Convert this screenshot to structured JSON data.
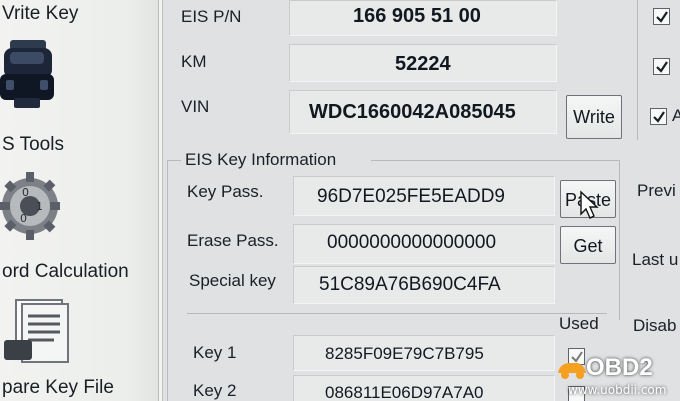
{
  "sidebar": {
    "items": [
      {
        "label": "Vrite Key",
        "icon": "key-write-icon"
      },
      {
        "label": "S Tools",
        "icon": "key-programmer-icon"
      },
      {
        "label": "ord Calculation",
        "icon": "gear-cog-icon"
      },
      {
        "label": "pare Key File",
        "icon": "document-icon"
      }
    ]
  },
  "eis": {
    "pn_label": "EIS P/N",
    "pn_value": "166 905 51 00",
    "km_label": "KM",
    "km_value": "52224",
    "vin_label": "VIN",
    "vin_value": "WDC1660042A085045",
    "write_button": "Write"
  },
  "key_info": {
    "group_title": "EIS Key Information",
    "key_pass_label": "Key Pass.",
    "key_pass_value": "96D7E025FE5EADD9",
    "erase_pass_label": "Erase Pass.",
    "erase_pass_value": "0000000000000000",
    "special_key_label": "Special key",
    "special_key_value": "51C89A76B690C4FA",
    "paste_button": "Paste",
    "get_button": "Get"
  },
  "keys": {
    "used_header": "Used",
    "disabled_header": "Disab",
    "rows": [
      {
        "label": "Key 1",
        "value": "8285F09E79C7B795"
      },
      {
        "label": "Key 2",
        "value": "086811E06D97A7A0"
      }
    ]
  },
  "right_panel": {
    "previous_label": "Previ",
    "last_label": "Last u",
    "checkbox_3_label": "A"
  },
  "watermark": {
    "brand": "OBD2",
    "url": "www.uobdii.com"
  }
}
